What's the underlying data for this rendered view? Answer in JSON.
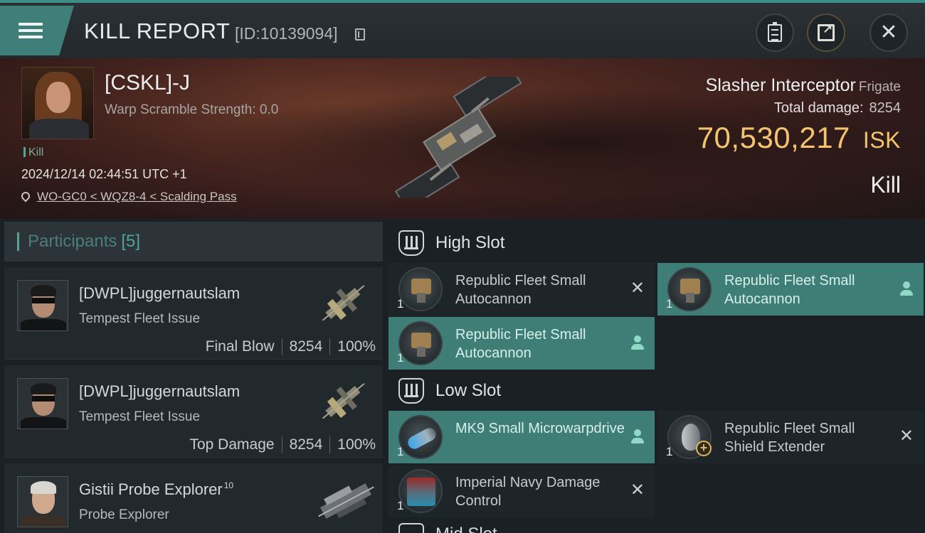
{
  "header": {
    "title": "KILL REPORT",
    "report_id": "[ID:10139094]"
  },
  "victim": {
    "name": "[CSKL]-J",
    "scramble": "Warp Scramble Strength: 0.0",
    "tag": "Kill",
    "timestamp": "2024/12/14 02:44:51 UTC +1",
    "location": "WO-GC0 < WQZ8-4 < Scalding Pass",
    "ship_name": "Slasher Interceptor",
    "ship_class": "Frigate",
    "damage_label": "Total damage:",
    "damage_value": "8254",
    "isk_value": "70,530,217",
    "isk_unit": "ISK",
    "result": "Kill"
  },
  "participants": {
    "title": "Participants",
    "count": "[5]",
    "rows": [
      {
        "name": "[DWPL]juggernautslam",
        "ship": "Tempest Fleet Issue",
        "role": "Final Blow",
        "damage": "8254",
        "pct": "100%"
      },
      {
        "name": "[DWPL]juggernautslam",
        "ship": "Tempest Fleet Issue",
        "role": "Top Damage",
        "damage": "8254",
        "pct": "100%"
      },
      {
        "name": "Gistii Probe Explorer",
        "level": "10",
        "ship": "Probe Explorer"
      }
    ]
  },
  "slots": {
    "high": {
      "title": "High Slot",
      "modules": [
        {
          "qty": "1",
          "name": "Republic Fleet Small Autocannon",
          "status": "destroyed",
          "icon": "autocannon-icon"
        },
        {
          "qty": "1",
          "name": "Republic Fleet Small Autocannon",
          "status": "dropped",
          "icon": "autocannon-icon"
        },
        {
          "qty": "1",
          "name": "Republic Fleet Small Autocannon",
          "status": "dropped",
          "icon": "autocannon-icon"
        }
      ]
    },
    "low": {
      "title": "Low Slot",
      "modules": [
        {
          "qty": "1",
          "name": "MK9 Small Microwarpdrive",
          "status": "dropped",
          "icon": "microwarpdrive-icon"
        },
        {
          "qty": "1",
          "name": "Republic Fleet Small Shield Extender",
          "status": "destroyed",
          "icon": "shield-extender-icon"
        },
        {
          "qty": "1",
          "name": "Imperial Navy Damage Control",
          "status": "destroyed",
          "icon": "damage-control-icon"
        }
      ]
    },
    "next_title": "Mid Slot"
  },
  "colors": {
    "accent": "#3f7e76",
    "isk": "#f2c46e",
    "panel": "#22292d"
  }
}
